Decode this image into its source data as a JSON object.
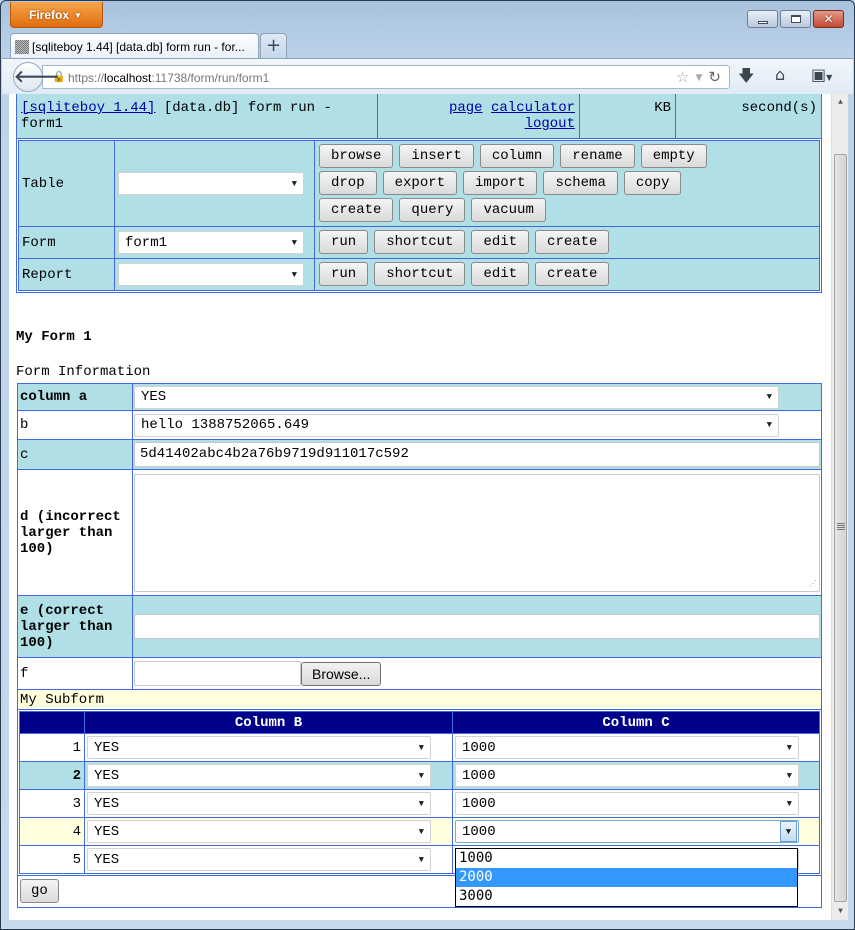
{
  "browser": {
    "app_button": "Firefox",
    "tab_title": "[sqliteboy 1.44] [data.db] form run - for...",
    "new_tab_label": "+",
    "url_scheme": "https://",
    "url_host": "localhost",
    "url_rest": ":11738/form/run/form1",
    "icons": [
      "back-icon",
      "lock-icon",
      "bookmark-star-icon",
      "dropdown-icon",
      "reload-icon",
      "download-icon",
      "home-icon",
      "bookmarks-menu-icon"
    ]
  },
  "header": {
    "app_link": "[sqliteboy 1.44]",
    "context": "[data.db] form run -",
    "context2": "form1",
    "links": [
      "page",
      "calculator",
      "logout"
    ],
    "size_unit": "KB",
    "time_unit": "second(s)"
  },
  "tools": {
    "rows": [
      {
        "label": "Table",
        "selected": "",
        "buttons": [
          "browse",
          "insert",
          "column",
          "rename",
          "empty",
          "drop",
          "export",
          "import",
          "schema",
          "copy",
          "create",
          "query",
          "vacuum"
        ]
      },
      {
        "label": "Form",
        "selected": "form1",
        "buttons": [
          "run",
          "shortcut",
          "edit",
          "create"
        ]
      },
      {
        "label": "Report",
        "selected": "",
        "buttons": [
          "run",
          "shortcut",
          "edit",
          "create"
        ]
      }
    ]
  },
  "form": {
    "title": "My Form 1",
    "caption": "Form Information",
    "fields": {
      "a": {
        "label": "column a",
        "value": "YES"
      },
      "b": {
        "label": "b",
        "value": "hello 1388752065.649"
      },
      "c": {
        "label": "c",
        "value": "5d41402abc4b2a76b9719d911017c592"
      },
      "d": {
        "label": "d (incorrect larger than 100)",
        "value": ""
      },
      "e": {
        "label": "e (correct larger than 100)",
        "value": ""
      },
      "f": {
        "label": "f",
        "value": "",
        "browse_label": "Browse..."
      }
    },
    "subform": {
      "title": "My Subform",
      "columns": [
        "",
        "Column B",
        "Column C"
      ],
      "rows": [
        {
          "num": "1",
          "b": "YES",
          "c": "1000"
        },
        {
          "num": "2",
          "b": "YES",
          "c": "1000"
        },
        {
          "num": "3",
          "b": "YES",
          "c": "1000"
        },
        {
          "num": "4",
          "b": "YES",
          "c": "1000"
        },
        {
          "num": "5",
          "b": "YES",
          "c": "1000"
        }
      ],
      "open_dropdown": {
        "row": 4,
        "options": [
          "1000",
          "2000",
          "3000"
        ],
        "highlighted": "2000"
      }
    },
    "submit_label": "go"
  }
}
